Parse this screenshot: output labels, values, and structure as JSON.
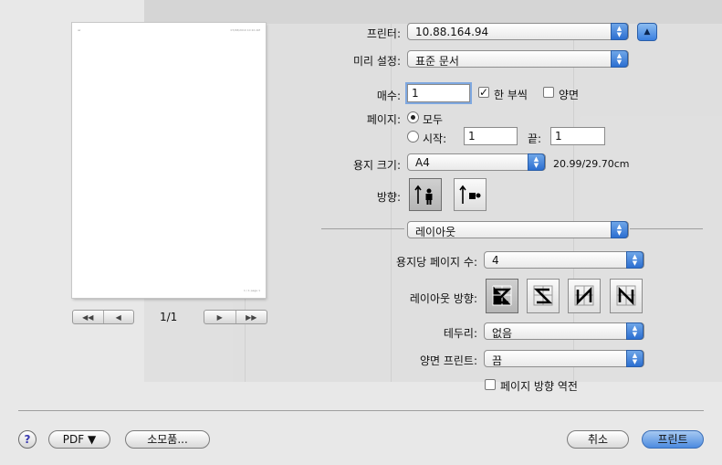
{
  "preview": {
    "header_left": "ዘዘ",
    "header_right": "07/08/2010 10:10 AM",
    "footer_right": "1 / 1 page 1",
    "page_indicator": "1/1"
  },
  "printer": {
    "label": "프린터:",
    "value": "10.88.164.94"
  },
  "presets": {
    "label": "미리 설정:",
    "value": "표준 문서"
  },
  "copies": {
    "label": "매수:",
    "value": "1",
    "collated_label": "한 부씩",
    "collated_checked": true,
    "duplex_label": "양면",
    "duplex_checked": false
  },
  "pages": {
    "label": "페이지:",
    "all_label": "모두",
    "range_label": "시작:",
    "from_value": "1",
    "to_label": "끝:",
    "to_value": "1"
  },
  "paper_size": {
    "label": "용지 크기:",
    "value": "A4",
    "dimensions": "20.99/29.70cm"
  },
  "orientation": {
    "label": "방향:"
  },
  "section": {
    "value": "레이아웃"
  },
  "pages_per_sheet": {
    "label": "용지당 페이지 수:",
    "value": "4"
  },
  "layout_direction": {
    "label": "레이아웃 방향:"
  },
  "border": {
    "label": "테두리:",
    "value": "없음"
  },
  "two_sided": {
    "label": "양면 프린트:",
    "value": "끔"
  },
  "reverse_orientation": {
    "label": "페이지 방향 역전",
    "checked": false
  },
  "footer": {
    "help": "?",
    "pdf": "PDF ▼",
    "supplies": "소모품...",
    "cancel": "취소",
    "print": "프린트"
  },
  "colors": {
    "accent": "#3a7fe0",
    "default_button": "#6aa2ea"
  }
}
